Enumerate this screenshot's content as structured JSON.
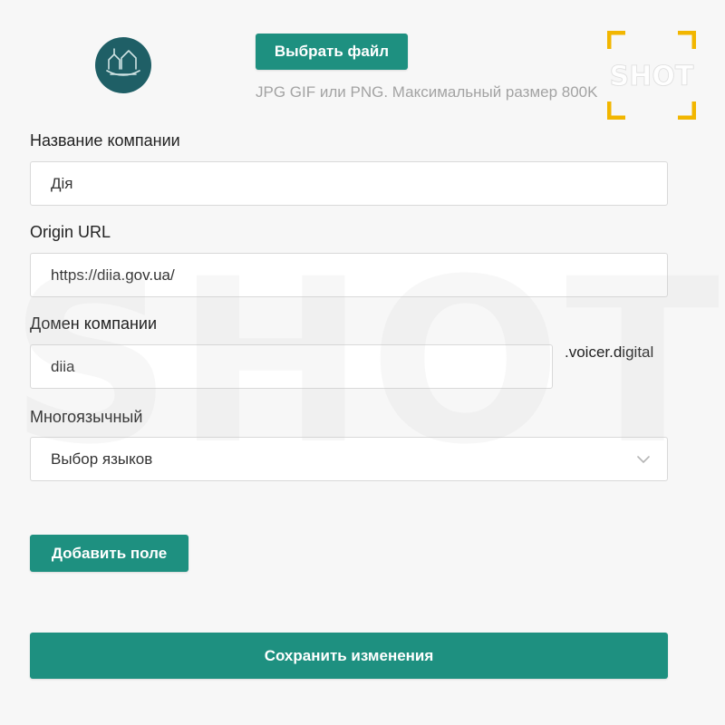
{
  "logo": {
    "icon": "diia-logo-icon",
    "color": "#1f5f66"
  },
  "upload": {
    "button_label": "Выбрать файл",
    "hint": "JPG GIF или PNG. Максимальный размер 800K"
  },
  "company_name": {
    "label": "Название компании",
    "value": "Дія"
  },
  "origin_url": {
    "label": "Origin URL",
    "value": "https://diia.gov.ua/"
  },
  "company_domain": {
    "label": "Домен компании",
    "value": "diia",
    "suffix": ".voicer.digital"
  },
  "multilingual": {
    "label": "Многоязычный",
    "selected": "Выбор языков"
  },
  "add_field": {
    "label": "Добавить поле"
  },
  "save": {
    "label": "Сохранить изменения"
  },
  "watermark": {
    "text": "SHOT",
    "badge_text": "SHOT",
    "badge_color": "#f2b600"
  },
  "colors": {
    "accent": "#1e9080",
    "background": "#f7f7f7"
  }
}
